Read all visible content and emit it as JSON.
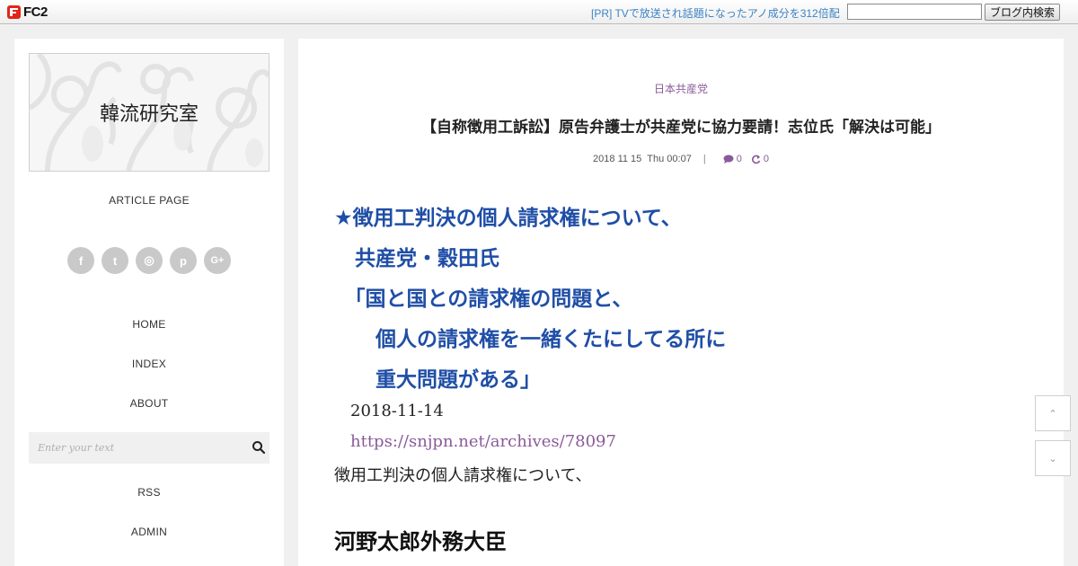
{
  "fc2bar": {
    "logo_text": "FC2",
    "ad_text": "[PR] TVで放送され話題になったアノ成分を312倍配",
    "search_button": "ブログ内検索"
  },
  "sidebar": {
    "blog_title": "韓流研究室",
    "page_type": "ARTICLE PAGE",
    "social_icons": [
      {
        "name": "facebook-icon",
        "glyph": "f"
      },
      {
        "name": "twitter-icon",
        "glyph": "t"
      },
      {
        "name": "instagram-icon",
        "glyph": "◎"
      },
      {
        "name": "pinterest-icon",
        "glyph": "p"
      },
      {
        "name": "google-plus-icon",
        "glyph": "G+"
      }
    ],
    "nav": [
      "HOME",
      "INDEX",
      "ABOUT"
    ],
    "search_placeholder": "Enter your text",
    "nav_bottom": [
      "RSS",
      "ADMIN"
    ]
  },
  "post": {
    "category": "日本共産党",
    "title": "【自称徴用工訴訟】原告弁護士が共産党に協力要請！志位氏「解決は可能」",
    "date": "2018 11 15",
    "time": "Thu 00:07",
    "comments": "0",
    "trackbacks": "0",
    "highlight_lines": [
      "★徴用工判決の個人請求権について、",
      "　共産党・穀田氏",
      "　「国と国との請求権の問題と、",
      "　　個人の請求権を一緒くたにしてる所に",
      "　　重大問題がある」"
    ],
    "source_date": "2018-11-14",
    "source_url": "https://snjpn.net/archives/78097",
    "body_line": "徴用工判決の個人請求権について、",
    "subheading": "河野太郎外務大臣"
  },
  "scroll": {
    "up_glyph": "⌃",
    "down_glyph": "⌄"
  },
  "colors": {
    "accent_purple": "#8a5a9a",
    "highlight_blue": "#1f4ea6",
    "fc2_link": "#3b82c4"
  }
}
